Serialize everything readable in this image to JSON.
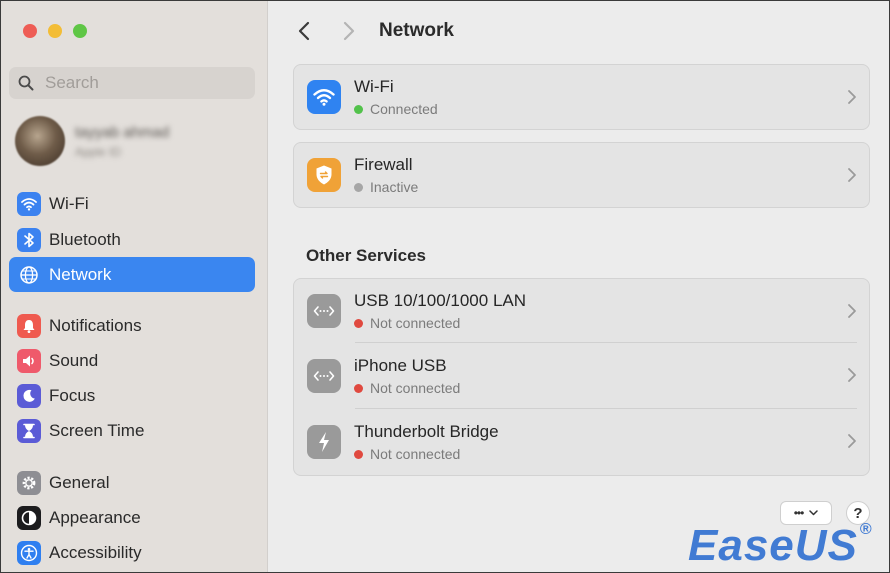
{
  "sidebar": {
    "search_placeholder": "Search",
    "profile": {
      "name": "tayyab ahmad",
      "sub": "Apple ID"
    },
    "items": [
      {
        "label": "Wi-Fi",
        "icon": "wifi-icon",
        "color": "#3b82f0"
      },
      {
        "label": "Bluetooth",
        "icon": "bluetooth-icon",
        "color": "#3b82f0"
      },
      {
        "label": "Network",
        "icon": "globe-icon",
        "color": "#ffffff",
        "active": true
      },
      {
        "label": "Notifications",
        "icon": "bell-icon",
        "color": "#ef5a4f"
      },
      {
        "label": "Sound",
        "icon": "speaker-icon",
        "color": "#ef5a6b"
      },
      {
        "label": "Focus",
        "icon": "moon-icon",
        "color": "#5b5bd6"
      },
      {
        "label": "Screen Time",
        "icon": "hourglass-icon",
        "color": "#5b5bd6"
      },
      {
        "label": "General",
        "icon": "gear-icon",
        "color": "#8e8e93"
      },
      {
        "label": "Appearance",
        "icon": "appearance-icon",
        "color": "#1c1c1e"
      },
      {
        "label": "Accessibility",
        "icon": "accessibility-icon",
        "color": "#2f7ff0"
      }
    ]
  },
  "main": {
    "title": "Network",
    "wifi": {
      "title": "Wi-Fi",
      "status": "Connected",
      "status_color": "#52c24b",
      "icon_color": "#2f83f1"
    },
    "firewall": {
      "title": "Firewall",
      "status": "Inactive",
      "status_color": "#a6a6a6",
      "icon_color": "#f0a237"
    },
    "other_services_label": "Other Services",
    "services": [
      {
        "title": "USB 10/100/1000 LAN",
        "status": "Not connected",
        "status_color": "#e0493f",
        "icon": "ethernet-icon"
      },
      {
        "title": "iPhone USB",
        "status": "Not connected",
        "status_color": "#e0493f",
        "icon": "ethernet-icon"
      },
      {
        "title": "Thunderbolt Bridge",
        "status": "Not connected",
        "status_color": "#e0493f",
        "icon": "thunderbolt-icon"
      }
    ],
    "more_label": "•••",
    "help_label": "?"
  },
  "watermark": {
    "text": "EaseUS",
    "reg": "®"
  }
}
